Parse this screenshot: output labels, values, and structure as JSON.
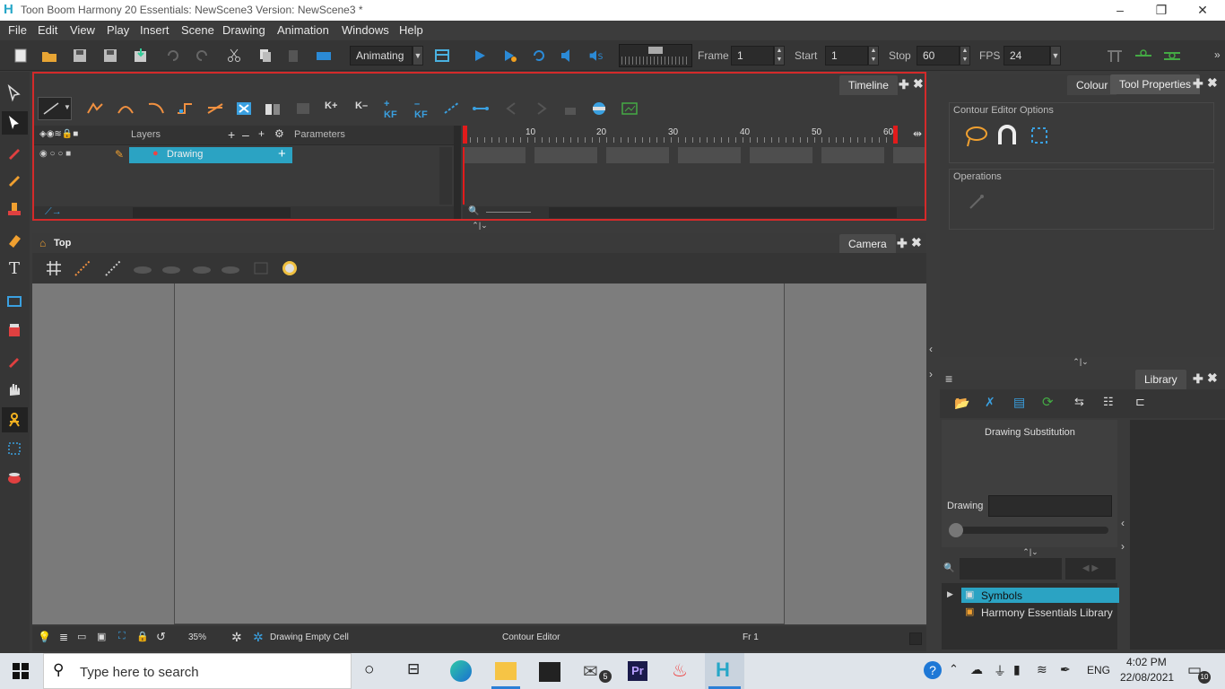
{
  "window": {
    "title": "Toon Boom Harmony 20 Essentials: NewScene3 Version: NewScene3 *",
    "app_icon": "harmony-h-icon",
    "minimize": "–",
    "restore": "❐",
    "close": "✕"
  },
  "menu": [
    "File",
    "Edit",
    "View",
    "Play",
    "Insert",
    "Scene",
    "Drawing",
    "Animation",
    "Windows",
    "Help"
  ],
  "toolbar": {
    "mode_value": "Animating",
    "frame_label": "Frame",
    "frame_value": "1",
    "start_label": "Start",
    "start_value": "1",
    "stop_label": "Stop",
    "stop_value": "60",
    "fps_label": "FPS",
    "fps_value": "24"
  },
  "timeline": {
    "tab": "Timeline",
    "layers_header": "Layers",
    "parameters_header": "Parameters",
    "layer_name": "Drawing",
    "ruler_ticks": [
      "10",
      "20",
      "30",
      "40",
      "50",
      "60"
    ]
  },
  "camera_view": {
    "breadcrumb": "Top",
    "tab": "Camera",
    "zoom": "35%",
    "status_cell": "Drawing Empty Cell",
    "status_tool": "Contour Editor",
    "status_frame": "Fr 1"
  },
  "tool_properties": {
    "tab_colour": "Colour",
    "tab_tool_properties": "Tool Properties",
    "section_options": "Contour Editor Options",
    "section_operations": "Operations"
  },
  "library": {
    "tab": "Library",
    "substitution_title": "Drawing Substitution",
    "drawing_label": "Drawing",
    "tree": [
      "Symbols",
      "Harmony Essentials Library"
    ]
  },
  "taskbar": {
    "search_placeholder": "Type here to search",
    "mail_badge": "5",
    "lang": "ENG",
    "time": "4:02 PM",
    "date": "22/08/2021",
    "notif_count": "10"
  },
  "colors": {
    "accent_cyan": "#2ba3c3",
    "active_border_red": "#d42a2a",
    "playhead_red": "#e21b1b",
    "panel_bg": "#3a3a3a"
  }
}
